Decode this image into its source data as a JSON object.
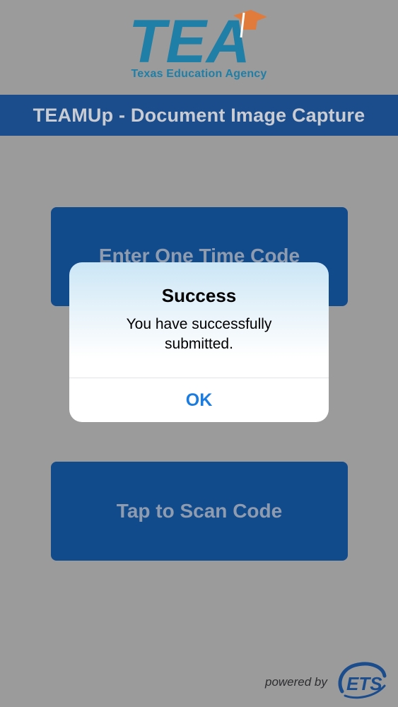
{
  "header": {
    "logo_text": "TEA",
    "agency_name": "Texas Education Agency"
  },
  "title_bar": {
    "title": "TEAMUp - Document Image Capture"
  },
  "buttons": {
    "enter_code": "Enter One Time Code",
    "scan_code": "Tap to Scan Code"
  },
  "dialog": {
    "title": "Success",
    "message": "You have successfully submitted.",
    "ok_label": "OK"
  },
  "footer": {
    "powered_by": "powered by",
    "ets_text": "ETS"
  },
  "colors": {
    "title_bar": "#1b4c8c",
    "button": "#114b8c",
    "logo_blue": "#1f7fa6",
    "logo_orange": "#e07b3c",
    "ok_blue": "#1a7be0"
  }
}
